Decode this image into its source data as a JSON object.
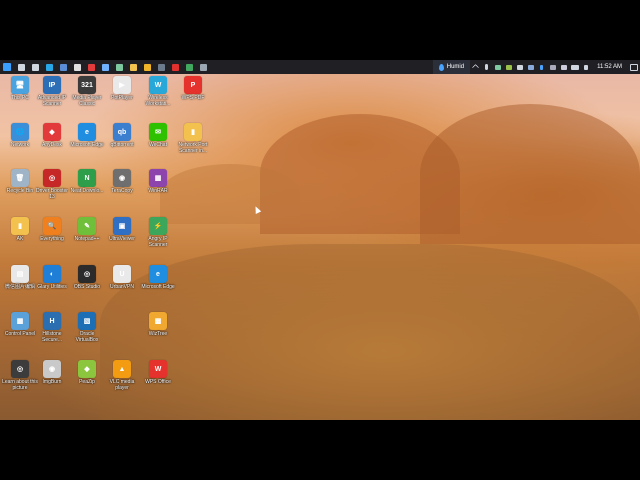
{
  "taskbar": {
    "weather_label": "Humid",
    "clock": "11:52 AM",
    "apps": [
      {
        "name": "windows-start-icon",
        "color": "#3aa0ff"
      },
      {
        "name": "search-icon",
        "color": "#cfd6e0"
      },
      {
        "name": "task-view-icon",
        "color": "#cfd6e0"
      },
      {
        "name": "edge-taskbar-icon",
        "color": "#27a6e8"
      },
      {
        "name": "photos-taskbar-icon",
        "color": "#5b8dd6"
      },
      {
        "name": "notepad-taskbar-icon",
        "color": "#e0e0e0"
      },
      {
        "name": "vivaldi-taskbar-icon",
        "color": "#e23b3b"
      },
      {
        "name": "app-taskbar-icon",
        "color": "#6fb1ff"
      },
      {
        "name": "app-taskbar-icon-2",
        "color": "#7ec8a0"
      },
      {
        "name": "explorer-taskbar-icon",
        "color": "#f2c14e"
      },
      {
        "name": "chrome-taskbar-icon",
        "color": "#f0b428"
      },
      {
        "name": "app-taskbar-icon-3",
        "color": "#6c7b8b"
      },
      {
        "name": "opera-taskbar-icon",
        "color": "#e0312e"
      },
      {
        "name": "chrome-taskbar-icon-2",
        "color": "#41a85f"
      },
      {
        "name": "obs-taskbar-icon",
        "color": "#9aa6b2"
      }
    ]
  },
  "desktop": {
    "icons": [
      {
        "label": "This PC",
        "col": 0,
        "row": 0,
        "color": "#4aa3df",
        "glyph": "🖥"
      },
      {
        "label": "Advanced IP Scanner",
        "col": 1,
        "row": 0,
        "color": "#2d6fb7",
        "glyph": "IP"
      },
      {
        "label": "Media Player Classic",
        "col": 2,
        "row": 0,
        "color": "#3b3b3b",
        "glyph": "321"
      },
      {
        "label": "PotPlayer",
        "col": 3,
        "row": 0,
        "color": "#e9e9e9",
        "glyph": "▶"
      },
      {
        "label": "Wireless Workstati...",
        "col": 4,
        "row": 0,
        "color": "#27a8d8",
        "glyph": "W"
      },
      {
        "label": "WPS PDF",
        "col": 5,
        "row": 0,
        "color": "#e5322d",
        "glyph": "P"
      },
      {
        "label": "Network",
        "col": 0,
        "row": 1,
        "color": "#3b8fd9",
        "glyph": "🌐"
      },
      {
        "label": "AnyDesk",
        "col": 1,
        "row": 1,
        "color": "#e23a3a",
        "glyph": "◆"
      },
      {
        "label": "Microsoft Edge",
        "col": 2,
        "row": 1,
        "color": "#1f8ee0",
        "glyph": "e"
      },
      {
        "label": "qBittorrent",
        "col": 3,
        "row": 1,
        "color": "#3d7fcf",
        "glyph": "qb"
      },
      {
        "label": "WeChat",
        "col": 4,
        "row": 1,
        "color": "#2dc100",
        "glyph": "✉"
      },
      {
        "label": "Network Port Scanner in...",
        "col": 5,
        "row": 1,
        "color": "#f2c14e",
        "glyph": "▮"
      },
      {
        "label": "Recycle Bin",
        "col": 0,
        "row": 2,
        "color": "#9fb4c6",
        "glyph": "🗑"
      },
      {
        "label": "Driver Booster 13",
        "col": 1,
        "row": 2,
        "color": "#c62828",
        "glyph": "◎"
      },
      {
        "label": "Neat Downlo...",
        "col": 2,
        "row": 2,
        "color": "#2e9e4a",
        "glyph": "N"
      },
      {
        "label": "TeraCopy",
        "col": 3,
        "row": 2,
        "color": "#6f6f6f",
        "glyph": "◉"
      },
      {
        "label": "WinRAR",
        "col": 4,
        "row": 2,
        "color": "#8e44ad",
        "glyph": "▦"
      },
      {
        "label": "AK",
        "col": 0,
        "row": 3,
        "color": "#f2c14e",
        "glyph": "▮"
      },
      {
        "label": "Everything",
        "col": 1,
        "row": 3,
        "color": "#f07f1e",
        "glyph": "🔍"
      },
      {
        "label": "Notepad++",
        "col": 2,
        "row": 3,
        "color": "#6fbf3a",
        "glyph": "✎"
      },
      {
        "label": "UltraViewer",
        "col": 3,
        "row": 3,
        "color": "#2f6fc4",
        "glyph": "▣"
      },
      {
        "label": "Angry IP Scanner",
        "col": 4,
        "row": 3,
        "color": "#3ca75a",
        "glyph": "⚡"
      },
      {
        "label": "微信图片编辑",
        "col": 0,
        "row": 4,
        "color": "#e8e8e8",
        "glyph": "▤"
      },
      {
        "label": "Glary Utilities",
        "col": 1,
        "row": 4,
        "color": "#1f7fd6",
        "glyph": "◐"
      },
      {
        "label": "OBS Studio",
        "col": 2,
        "row": 4,
        "color": "#2b2b2b",
        "glyph": "◎"
      },
      {
        "label": "UrbanVPN",
        "col": 3,
        "row": 4,
        "color": "#e9e9e9",
        "glyph": "U"
      },
      {
        "label": "Microsoft Edge",
        "col": 4,
        "row": 4,
        "color": "#1f8ee0",
        "glyph": "e"
      },
      {
        "label": "Control Panel",
        "col": 0,
        "row": 5,
        "color": "#5aa0d9",
        "glyph": "▦"
      },
      {
        "label": "Hillstone Secure...",
        "col": 1,
        "row": 5,
        "color": "#2b6fb0",
        "glyph": "H"
      },
      {
        "label": "Oracle VirtualBox",
        "col": 2,
        "row": 5,
        "color": "#1c6fb5",
        "glyph": "▧"
      },
      {
        "label": "WizTree",
        "col": 4,
        "row": 5,
        "color": "#f0a830",
        "glyph": "▩"
      },
      {
        "label": "Learn about this picture",
        "col": 0,
        "row": 6,
        "color": "#3c3c3c",
        "glyph": "◎"
      },
      {
        "label": "ImgBurn",
        "col": 1,
        "row": 6,
        "color": "#c9c9c9",
        "glyph": "◉"
      },
      {
        "label": "PeaZip",
        "col": 2,
        "row": 6,
        "color": "#8cc63f",
        "glyph": "◆"
      },
      {
        "label": "VLC media player",
        "col": 3,
        "row": 6,
        "color": "#f39c12",
        "glyph": "▲"
      },
      {
        "label": "WPS Office",
        "col": 4,
        "row": 6,
        "color": "#e5322d",
        "glyph": "W"
      }
    ]
  }
}
